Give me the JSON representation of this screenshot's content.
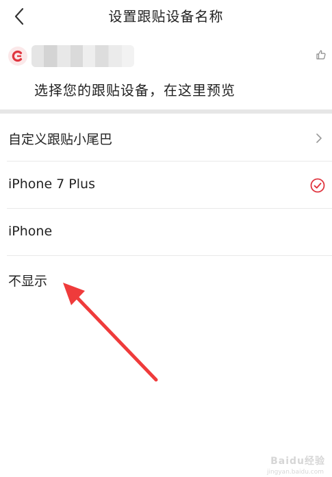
{
  "header": {
    "title": "设置跟贴设备名称",
    "back_icon": "chevron-left-icon"
  },
  "preview": {
    "text": "选择您的跟贴设备，在这里预览",
    "avatar_icon": "app-logo-icon",
    "like_icon": "thumbs-up-icon"
  },
  "options": {
    "custom_label": "自定义跟贴小尾巴",
    "iphone7plus_label": "iPhone 7 Plus",
    "iphone_label": "iPhone",
    "hide_label": "不显示",
    "selected": "iPhone 7 Plus"
  },
  "colors": {
    "accent": "#e0353f",
    "arrow": "#ef3b3b",
    "divider": "#e6e6e6"
  },
  "watermark": {
    "text": "Baidu经验",
    "sub": "jingyan.baidu.com"
  }
}
